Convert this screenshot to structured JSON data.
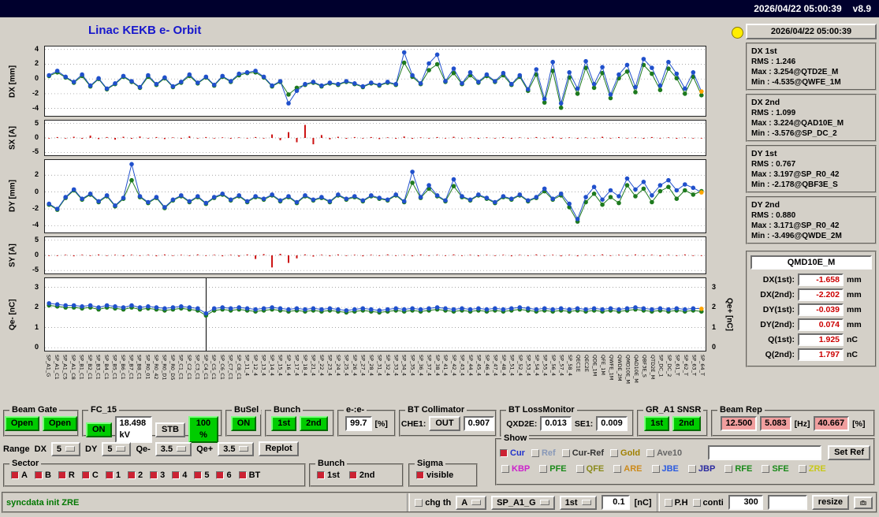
{
  "titlebar": {
    "datetime": "2026/04/22 05:00:39",
    "version": "v8.9"
  },
  "header": {
    "title": "Linac KEKB e- Orbit"
  },
  "stats": {
    "datetime": "2026/04/22 05:00:39",
    "groups": [
      {
        "name": "DX 1st",
        "lines": [
          "RMS : 1.246",
          "Max : 3.254@QTD2E_M",
          "Min : -4.535@QWFE_1M"
        ]
      },
      {
        "name": "DX 2nd",
        "lines": [
          "RMS : 1.099",
          "Max : 3.224@QAD10E_M",
          "Min : -3.576@SP_DC_2"
        ]
      },
      {
        "name": "DY 1st",
        "lines": [
          "RMS : 0.767",
          "Max : 3.197@SP_R0_42",
          "Min : -2.178@QBF3E_S"
        ]
      },
      {
        "name": "DY 2nd",
        "lines": [
          "RMS : 0.880",
          "Max : 3.171@SP_R0_42",
          "Min : -3.496@QWDE_2M"
        ]
      }
    ]
  },
  "qmd": {
    "title": "QMD10E_M",
    "rows": [
      {
        "label": "DX(1st):",
        "value": "-1.658",
        "unit": "mm"
      },
      {
        "label": "DX(2nd):",
        "value": "-2.202",
        "unit": "mm"
      },
      {
        "label": "DY(1st):",
        "value": "-0.039",
        "unit": "mm"
      },
      {
        "label": "DY(2nd):",
        "value": "0.074",
        "unit": "mm"
      },
      {
        "label": "Q(1st):",
        "value": "1.925",
        "unit": "nC"
      },
      {
        "label": "Q(2nd):",
        "value": "1.797",
        "unit": "nC"
      }
    ]
  },
  "panels": {
    "beam_gate": {
      "title": "Beam Gate",
      "buttons": [
        "Open",
        "Open"
      ]
    },
    "fc15": {
      "title": "FC_15",
      "on": "ON",
      "kv": "18.498 kV",
      "stb": "STB",
      "pct": "100 %"
    },
    "busel": {
      "title": "BuSel",
      "on": "ON"
    },
    "bunch": {
      "title": "Bunch",
      "b1": "1st",
      "b2": "2nd"
    },
    "ee": {
      "title": "e-:e-",
      "value": "99.7",
      "unit": "[%]"
    },
    "bt_collimator": {
      "title": "BT Collimator",
      "che1_label": "CHE1:",
      "che1_state": "OUT",
      "che1_value": "0.907"
    },
    "bt_lossmonitor": {
      "title": "BT LossMonitor",
      "qxd2e_label": "QXD2E:",
      "qxd2e_value": "0.013",
      "se1_label": "SE1:",
      "se1_value": "0.009"
    },
    "gr_snsr": {
      "title": "GR_A1 SNSR",
      "b1": "1st",
      "b2": "2nd"
    },
    "beam_rep": {
      "title": "Beam Rep",
      "v1": "12.500",
      "v2": "5.083",
      "hz": "[Hz]",
      "v3": "40.667",
      "pct": "[%]"
    }
  },
  "range": {
    "label": "Range",
    "dx_label": "DX",
    "dx_value": "5",
    "dy_label": "DY",
    "dy_value": "5",
    "qem_label": "Qe-",
    "qem_value": "3.5",
    "qep_label": "Qe+",
    "qep_value": "3.5",
    "replot": "Replot"
  },
  "show": {
    "title": "Show",
    "ref_entry": "",
    "set_ref": "Set Ref",
    "row1": [
      {
        "label": "Cur",
        "checked": true,
        "check_color": "#cc2233",
        "color": "#2233cc"
      },
      {
        "label": "Ref",
        "checked": false,
        "color": "#8898b8"
      },
      {
        "label": "Cur-Ref",
        "checked": false,
        "color": "#333333"
      },
      {
        "label": "Gold",
        "checked": false,
        "color": "#a08000"
      },
      {
        "label": "Ave10",
        "checked": false,
        "color": "#666666"
      }
    ],
    "row2": [
      {
        "label": "KBP",
        "color": "#cc22cc"
      },
      {
        "label": "PFE",
        "color": "#1a8a1a"
      },
      {
        "label": "QFE",
        "color": "#8a8a1a"
      },
      {
        "label": "ARE",
        "color": "#cc8a1a"
      },
      {
        "label": "JBE",
        "color": "#2a5ae0"
      },
      {
        "label": "JBP",
        "color": "#2a2aa0"
      },
      {
        "label": "RFE",
        "color": "#1a8a1a"
      },
      {
        "label": "SFE",
        "color": "#1a8a1a"
      },
      {
        "label": "ZRE",
        "color": "#c8c81a"
      }
    ]
  },
  "sector": {
    "title": "Sector",
    "check_color": "#cc2233",
    "items": [
      "A",
      "B",
      "R",
      "C",
      "1",
      "2",
      "3",
      "4",
      "5",
      "6",
      "BT"
    ]
  },
  "bunch2": {
    "title": "Bunch",
    "check_color": "#cc2233",
    "items": [
      "1st",
      "2nd"
    ]
  },
  "sigma": {
    "title": "Sigma",
    "check_color": "#cc2233",
    "items": [
      "visible"
    ]
  },
  "statusbar": {
    "message": "syncdata init ZRE",
    "chg_th": "chg th",
    "mode": "A",
    "device": "SP_A1_G",
    "bunch": "1st",
    "threshold": "0.1",
    "unit": "[nC]",
    "ph": "P.H",
    "conti": "conti",
    "interval": "300",
    "blank": "",
    "resize": "resize"
  },
  "xlabels": [
    "SP_A1_G",
    "SP_A1_C1",
    "SP_A1_C5",
    "SP_A1_C8",
    "SP_B1_C1",
    "SP_B2_C1",
    "SP_B3_C1",
    "SP_B4_C1",
    "SP_B5_C1",
    "SP_B6_C1",
    "SP_B7_C1",
    "SP_B8_C1",
    "SP_R0_01",
    "SP_R0_42",
    "SP_R0_D1",
    "SP_R0_D5",
    "SP_C1_C1",
    "SP_C2_C1",
    "SP_C3_C1",
    "SP_C4_C1",
    "SP_C5_C1",
    "SP_C6_C1",
    "SP_C7_C1",
    "SP_C8_C1",
    "SP_11_4",
    "SP_12_4",
    "SP_13_4",
    "SP_14_4",
    "SP_15_4",
    "SP_16_4",
    "SP_17_4",
    "SP_18_4",
    "SP_21_4",
    "SP_22_4",
    "SP_23_4",
    "SP_24_4",
    "SP_25_4",
    "SP_26_4",
    "SP_27_4",
    "SP_28_4",
    "SP_31_4",
    "SP_32_4",
    "SP_33_4",
    "SP_34_4",
    "SP_35_4",
    "SP_36_4",
    "SP_37_4",
    "SP_38_4",
    "SP_41_4",
    "SP_42_4",
    "SP_43_4",
    "SP_44_4",
    "SP_45_4",
    "SP_46_4",
    "SP_47_4",
    "SP_48_4",
    "SP_51_4",
    "SP_52_4",
    "SP_53_4",
    "SP_54_4",
    "SP_55_4",
    "SP_56_4",
    "SP_57_4",
    "SP_58_4",
    "QEC1E",
    "QEC2E",
    "QDE_1M",
    "QFE_1M",
    "QWFE_1M",
    "QWDE_2M",
    "QMD10E_M",
    "QAD10E_M",
    "QBF3E_S",
    "QTD2E_M",
    "SP_DC_1",
    "SP_DC_2",
    "SP_61_T",
    "SP_62_T",
    "SP_63_T",
    "SP_64_T"
  ],
  "chart_data": [
    {
      "type": "scatter-line",
      "name": "DX",
      "ylabel": "DX [mm]",
      "ylim": [
        -5,
        4.4
      ],
      "yticks": [
        4,
        2,
        0,
        -2,
        -4
      ],
      "grid": true,
      "series": [
        {
          "name": "2nd bunch",
          "color": "#1e7a1e",
          "values": [
            0.4,
            0.9,
            0.2,
            -0.5,
            0.4,
            -1.0,
            0.0,
            -1.4,
            -0.7,
            0.3,
            -0.4,
            -1.2,
            0.3,
            -0.8,
            0.1,
            -1.1,
            -0.5,
            0.4,
            -0.6,
            0.2,
            -0.9,
            0.3,
            -0.4,
            0.5,
            0.8,
            0.9,
            0.2,
            -1.0,
            -0.4,
            -2.1,
            -1.2,
            -0.8,
            -0.5,
            -1.0,
            -0.6,
            -0.8,
            -0.4,
            -0.7,
            -1.1,
            -0.6,
            -0.9,
            -0.5,
            -0.8,
            2.2,
            0.3,
            -0.7,
            1.2,
            2.0,
            -0.4,
            0.8,
            -0.7,
            0.5,
            -0.5,
            0.4,
            -0.4,
            0.5,
            -0.8,
            0.3,
            -1.6,
            0.6,
            -3.2,
            1.1,
            -3.9,
            0.2,
            -2.0,
            1.5,
            -1.2,
            0.8,
            -2.6,
            0.1,
            1.0,
            -1.8,
            1.9,
            0.7,
            -1.5,
            1.4,
            0.1,
            -2.0,
            0.3,
            -2.2
          ]
        },
        {
          "name": "1st bunch",
          "color": "#2050cc",
          "last_color": "#ffa500",
          "values": [
            0.5,
            1.1,
            0.3,
            -0.4,
            0.6,
            -0.9,
            0.1,
            -1.3,
            -0.6,
            0.4,
            -0.3,
            -1.1,
            0.5,
            -0.7,
            0.2,
            -1.0,
            -0.4,
            0.6,
            -0.5,
            0.3,
            -0.8,
            0.4,
            -0.3,
            0.7,
            0.9,
            1.1,
            0.3,
            -0.9,
            -0.3,
            -3.3,
            -1.6,
            -0.7,
            -0.4,
            -0.9,
            -0.5,
            -0.7,
            -0.3,
            -0.6,
            -1.0,
            -0.5,
            -0.8,
            -0.4,
            -0.7,
            3.6,
            0.5,
            -0.6,
            2.1,
            3.3,
            -0.3,
            1.4,
            -0.6,
            0.9,
            -0.4,
            0.6,
            -0.3,
            0.8,
            -0.7,
            0.5,
            -1.4,
            1.3,
            -2.7,
            2.3,
            -3.3,
            0.9,
            -1.3,
            2.4,
            -0.7,
            1.6,
            -2.1,
            0.6,
            1.9,
            -1.1,
            2.7,
            1.5,
            -0.9,
            2.3,
            0.7,
            -1.3,
            0.9,
            -1.7
          ]
        }
      ]
    },
    {
      "type": "bar",
      "name": "SX",
      "ylabel": "SX [A]",
      "ylim": [
        -6,
        6
      ],
      "yticks": [
        5,
        0,
        -5
      ],
      "grid": true,
      "color": "#cc1111",
      "values": [
        0,
        0.3,
        -0.2,
        0.4,
        -0.3,
        0.8,
        -0.4,
        0.3,
        -0.6,
        0.4,
        -0.3,
        0.5,
        -0.2,
        0.3,
        -0.4,
        0.2,
        -0.3,
        0.6,
        -0.2,
        0.3,
        -0.2,
        0.2,
        -0.3,
        0.2,
        -0.2,
        0.3,
        -0.2,
        1.2,
        -0.8,
        2.0,
        -1.5,
        4.5,
        -2.2,
        1.0,
        -0.5,
        0.4,
        -0.3,
        0.3,
        -0.2,
        0.3,
        -0.4,
        0.2,
        -0.3,
        0.5,
        -0.3,
        0.2,
        -0.2,
        0.3,
        -0.2,
        0.4,
        -0.2,
        0.2,
        -0.3,
        0.2,
        -0.2,
        0.3,
        -0.3,
        0.2,
        -0.2,
        0.3,
        -0.2,
        0.4,
        -0.3,
        0.2,
        -0.3,
        0.2,
        -0.2,
        0.4,
        -0.2,
        0.3,
        -0.2,
        0.2,
        -0.3,
        0.3,
        -0.2,
        0.2,
        -0.3,
        0.2,
        -0.2,
        0
      ]
    },
    {
      "type": "scatter-line",
      "name": "DY",
      "ylabel": "DY [mm]",
      "ylim": [
        -4.8,
        3.8
      ],
      "yticks": [
        2,
        0,
        -2,
        -4
      ],
      "grid": true,
      "series": [
        {
          "name": "2nd bunch",
          "color": "#1e7a1e",
          "values": [
            -1.5,
            -2.1,
            -0.7,
            0.2,
            -0.9,
            -0.3,
            -1.2,
            -0.5,
            -1.7,
            -0.8,
            1.4,
            -0.6,
            -1.3,
            -0.7,
            -1.9,
            -1.0,
            -0.5,
            -1.2,
            -0.6,
            -1.4,
            -0.7,
            -0.3,
            -1.0,
            -0.5,
            -1.2,
            -0.6,
            -0.9,
            -0.4,
            -1.1,
            -0.6,
            -1.3,
            -0.5,
            -1.0,
            -0.7,
            -1.2,
            -0.4,
            -0.9,
            -0.6,
            -1.1,
            -0.5,
            -0.8,
            -1.0,
            -0.4,
            -1.2,
            1.1,
            -0.7,
            0.4,
            -0.5,
            -1.1,
            0.7,
            -0.6,
            -1.0,
            -0.4,
            -0.8,
            -1.3,
            -0.6,
            -0.9,
            -0.4,
            -1.1,
            -0.7,
            0.1,
            -0.9,
            -0.4,
            -1.8,
            -3.5,
            -1.2,
            -0.2,
            -1.5,
            -0.6,
            -1.3,
            0.8,
            -0.5,
            0.4,
            -1.2,
            0.1,
            0.6,
            -0.8,
            0.2,
            -0.3,
            0.1
          ]
        },
        {
          "name": "1st bunch",
          "color": "#2050cc",
          "last_color": "#ffa500",
          "values": [
            -1.4,
            -2.0,
            -0.6,
            0.3,
            -0.8,
            -0.2,
            -1.1,
            -0.4,
            -1.6,
            -0.7,
            3.3,
            -0.5,
            -1.2,
            -0.6,
            -1.8,
            -0.9,
            -0.4,
            -1.1,
            -0.5,
            -1.3,
            -0.6,
            -0.2,
            -0.9,
            -0.4,
            -1.1,
            -0.5,
            -0.8,
            -0.3,
            -1.0,
            -0.5,
            -1.2,
            -0.4,
            -0.9,
            -0.6,
            -1.1,
            -0.3,
            -0.8,
            -0.5,
            -1.0,
            -0.4,
            -0.7,
            -0.9,
            -0.3,
            -1.1,
            2.4,
            -0.6,
            0.8,
            -0.4,
            -1.0,
            1.5,
            -0.5,
            -0.9,
            -0.3,
            -0.7,
            -1.2,
            -0.5,
            -0.8,
            -0.3,
            -1.0,
            -0.6,
            0.4,
            -0.8,
            -0.2,
            -1.4,
            -3.2,
            -0.6,
            0.6,
            -0.9,
            0.2,
            -0.5,
            1.6,
            0.3,
            1.2,
            -0.4,
            0.8,
            1.4,
            0.2,
            0.9,
            0.5,
            -0.04
          ]
        }
      ]
    },
    {
      "type": "bar",
      "name": "SY",
      "ylabel": "SY [A]",
      "ylim": [
        -6,
        6
      ],
      "yticks": [
        5,
        0,
        -5
      ],
      "grid": true,
      "color": "#cc1111",
      "values": [
        0,
        -0.2,
        0.2,
        -0.3,
        0.2,
        -0.2,
        0.3,
        -0.2,
        0.2,
        -0.3,
        0.2,
        -0.2,
        0.2,
        -0.3,
        0.3,
        -0.2,
        0.2,
        -0.2,
        0.3,
        -0.2,
        0.2,
        -0.3,
        0.2,
        -0.4,
        0.3,
        -1.2,
        0.4,
        -4.0,
        0.5,
        -2.5,
        -1.0,
        0.3,
        -0.4,
        0.2,
        -0.3,
        0.3,
        -0.2,
        0.2,
        -0.3,
        0.2,
        -0.2,
        0.3,
        -0.2,
        0.2,
        -0.3,
        0.3,
        -0.2,
        0.2,
        -0.2,
        0.3,
        -0.2,
        0.2,
        -0.3,
        0.2,
        -0.2,
        0.2,
        -0.3,
        0.2,
        -0.2,
        0.3,
        -0.2,
        0.2,
        -0.3,
        0.2,
        -0.3,
        0.2,
        -0.2,
        0.3,
        -0.2,
        0.2,
        -0.2,
        0.3,
        -0.2,
        0.2,
        -0.3,
        0.2,
        -0.2,
        0.3,
        -0.2,
        0
      ]
    },
    {
      "type": "scatter-line",
      "name": "QE",
      "ylabel": "Qe- [nC]",
      "ylabel_right": "Qe+ [nC]",
      "ylim": [
        -0.15,
        3.45
      ],
      "yticks": [
        3,
        2,
        1,
        0
      ],
      "grid": true,
      "marker_x": 0.244,
      "series": [
        {
          "name": "2nd bunch",
          "color": "#1e7a1e",
          "values": [
            2.1,
            2.05,
            2.0,
            2.0,
            1.95,
            2.0,
            1.9,
            2.0,
            1.95,
            1.9,
            2.0,
            1.9,
            1.95,
            1.9,
            1.85,
            1.9,
            1.95,
            1.9,
            1.85,
            1.6,
            1.85,
            1.9,
            1.85,
            1.9,
            1.85,
            1.8,
            1.85,
            1.9,
            1.85,
            1.8,
            1.85,
            1.8,
            1.85,
            1.8,
            1.85,
            1.8,
            1.75,
            1.8,
            1.85,
            1.8,
            1.75,
            1.8,
            1.85,
            1.8,
            1.85,
            1.8,
            1.85,
            1.9,
            1.85,
            1.8,
            1.85,
            1.8,
            1.85,
            1.8,
            1.85,
            1.8,
            1.85,
            1.9,
            1.85,
            1.8,
            1.85,
            1.8,
            1.85,
            1.8,
            1.85,
            1.8,
            1.85,
            1.8,
            1.85,
            1.8,
            1.85,
            1.9,
            1.85,
            1.8,
            1.85,
            1.8,
            1.85,
            1.8,
            1.85,
            1.8
          ]
        },
        {
          "name": "1st bunch",
          "color": "#2050cc",
          "last_color": "#ffa500",
          "values": [
            2.2,
            2.15,
            2.1,
            2.1,
            2.05,
            2.1,
            2.0,
            2.1,
            2.05,
            2.0,
            2.1,
            2.0,
            2.05,
            2.0,
            1.95,
            2.0,
            2.05,
            2.0,
            1.95,
            1.7,
            1.95,
            2.0,
            1.95,
            2.0,
            1.95,
            1.9,
            1.95,
            2.0,
            1.95,
            1.9,
            1.95,
            1.9,
            1.95,
            1.9,
            1.95,
            1.9,
            1.85,
            1.9,
            1.95,
            1.9,
            1.85,
            1.9,
            1.95,
            1.9,
            1.95,
            1.9,
            1.95,
            2.0,
            1.95,
            1.9,
            1.95,
            1.9,
            1.95,
            1.9,
            1.95,
            1.9,
            1.95,
            2.0,
            1.95,
            1.9,
            1.95,
            1.9,
            1.95,
            1.9,
            1.95,
            1.9,
            1.95,
            1.9,
            1.95,
            1.9,
            1.95,
            2.0,
            1.95,
            1.9,
            1.95,
            1.9,
            1.95,
            1.9,
            1.95,
            1.93
          ]
        }
      ]
    }
  ]
}
